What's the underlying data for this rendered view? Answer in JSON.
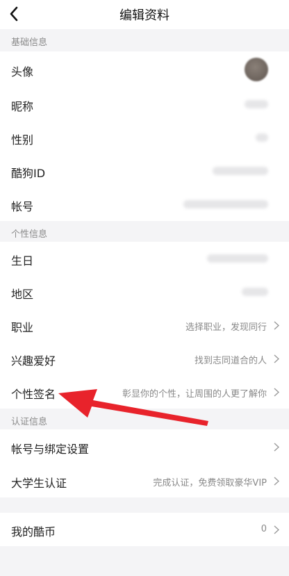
{
  "header": {
    "title": "编辑资料"
  },
  "sections": {
    "basic": "基础信息",
    "personal": "个性信息",
    "auth": "认证信息"
  },
  "rows": {
    "avatar": {
      "label": "头像"
    },
    "nickname": {
      "label": "昵称"
    },
    "gender": {
      "label": "性别"
    },
    "kugou_id": {
      "label": "酷狗ID"
    },
    "account": {
      "label": "帐号"
    },
    "birthday": {
      "label": "生日"
    },
    "region": {
      "label": "地区"
    },
    "job": {
      "label": "职业",
      "value": "选择职业，发现同行"
    },
    "hobby": {
      "label": "兴趣爱好",
      "value": "找到志同道合的人"
    },
    "signature": {
      "label": "个性签名",
      "value": "彰显你的个性，让周围的人更了解你"
    },
    "binding": {
      "label": "帐号与绑定设置"
    },
    "student": {
      "label": "大学生认证",
      "value": "完成认证，免费领取豪华VIP"
    },
    "coins": {
      "label": "我的酷币",
      "value": "0"
    }
  },
  "icons": {
    "back": "back-arrow-icon",
    "chevron": "chevron-right-icon"
  },
  "annotation_color": "#e8232b"
}
